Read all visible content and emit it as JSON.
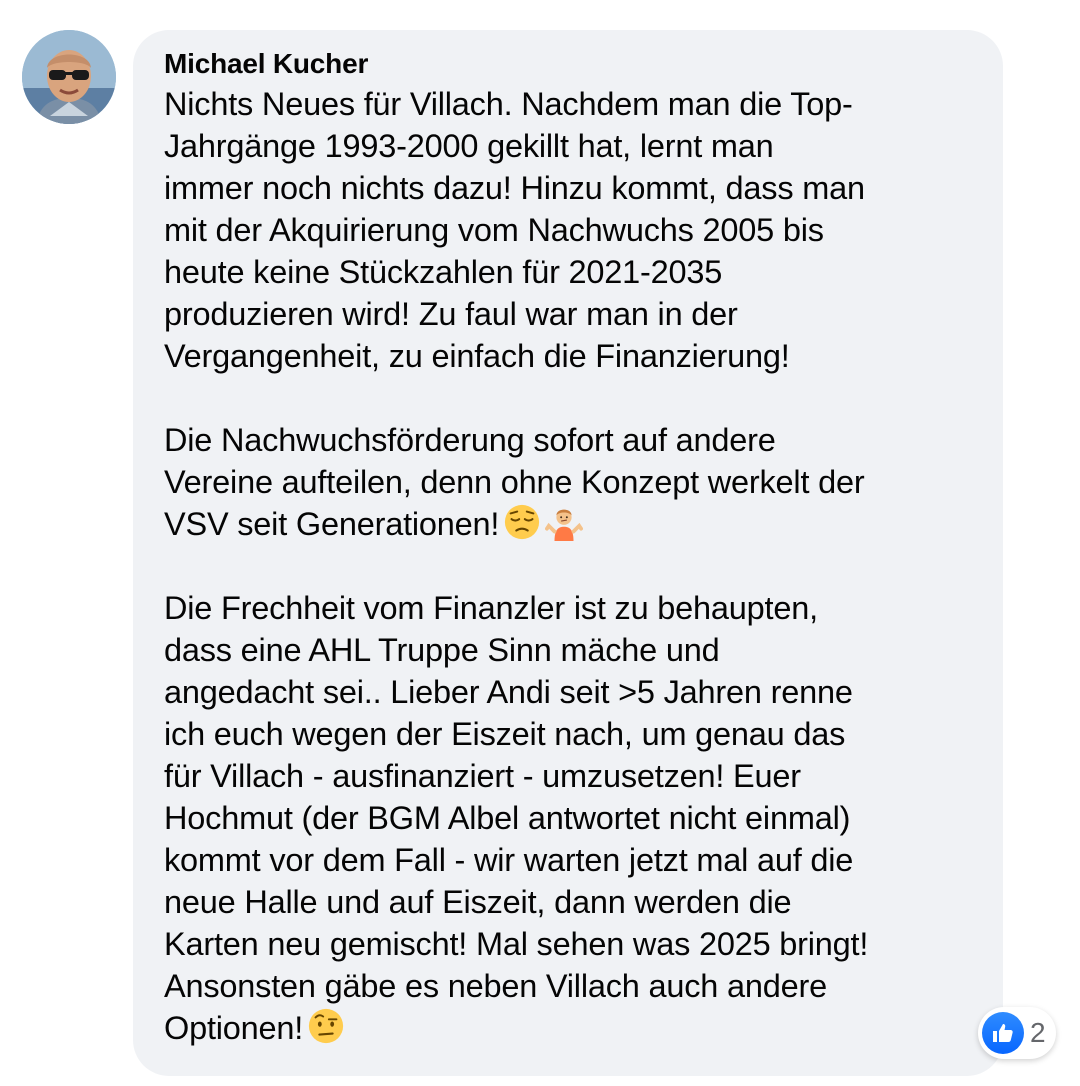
{
  "comment": {
    "author": "Michael Kucher",
    "paragraphs": [
      {
        "lines": [
          "Nichts Neues für Villach. Nachdem man die Top-",
          "Jahrgänge 1993-2000 gekillt hat, lernt man",
          "immer noch nichts dazu! Hinzu kommt, dass man",
          "mit der Akquirierung vom Nachwuchs 2005 bis",
          "heute keine Stückzahlen für 2021-2035",
          "produzieren wird! Zu faul war man in der",
          "Vergangenheit, zu einfach die Finanzierung!"
        ]
      },
      {
        "lines": [
          "Die Nachwuchsförderung sofort auf andere",
          "Vereine aufteilen, denn ohne Konzept werkelt der",
          "VSV seit Generationen!"
        ],
        "emojis": [
          "pensive-face-emoji",
          "person-shrugging-emoji"
        ]
      },
      {
        "lines": [
          "Die Frechheit vom Finanzler ist zu behaupten,",
          "dass eine AHL Truppe Sinn mäche und",
          "angedacht sei.. Lieber Andi seit >5 Jahren renne",
          "ich euch wegen der Eiszeit nach, um genau das",
          "für Villach - ausfinanziert - umzusetzen! Euer",
          "Hochmut (der BGM Albel antwortet nicht einmal)",
          "kommt vor dem Fall - wir warten jetzt mal auf die",
          "neue Halle und auf Eiszeit, dann werden die",
          "Karten neu gemischt! Mal sehen was 2025 bringt!",
          "Ansonsten gäbe es neben Villach auch andere",
          "Optionen!"
        ],
        "emojis": [
          "face-with-raised-eyebrow-emoji"
        ]
      }
    ]
  },
  "reactions": {
    "icon": "like-icon",
    "count": "2"
  },
  "colors": {
    "bubble_background": "#f0f2f5",
    "text": "#050505",
    "like_blue": "#0866ff",
    "count_gray": "#65676b"
  }
}
